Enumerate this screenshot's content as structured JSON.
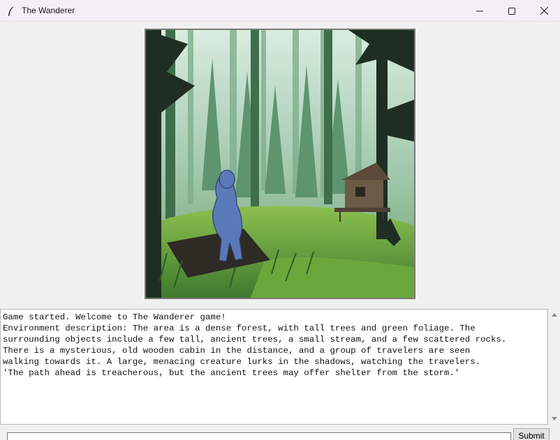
{
  "window": {
    "title": "The Wanderer",
    "icon": "feather-icon",
    "controls": [
      "minimize-icon",
      "maximize-icon",
      "close-icon"
    ]
  },
  "scene": {
    "description_icon": "forest-scene-illustration"
  },
  "log": {
    "text": "Game started. Welcome to The Wanderer game!\nEnvironment description: The area is a dense forest, with tall trees and green foliage. The\nsurrounding objects include a few tall, ancient trees, a small stream, and a few scattered rocks.\nThere is a mysterious, old wooden cabin in the distance, and a group of travelers are seen\nwalking towards it. A large, menacing creature lurks in the shadows, watching the travelers.\n'The path ahead is treacherous, but the ancient trees may offer shelter from the storm.'"
  },
  "input": {
    "value": "",
    "submit_label": "Submit"
  },
  "colors": {
    "background": "#f0f0f0",
    "titlebar": "#f3eff6",
    "forest_green": "#5e9a4a",
    "mist": "#b9d6bf"
  }
}
